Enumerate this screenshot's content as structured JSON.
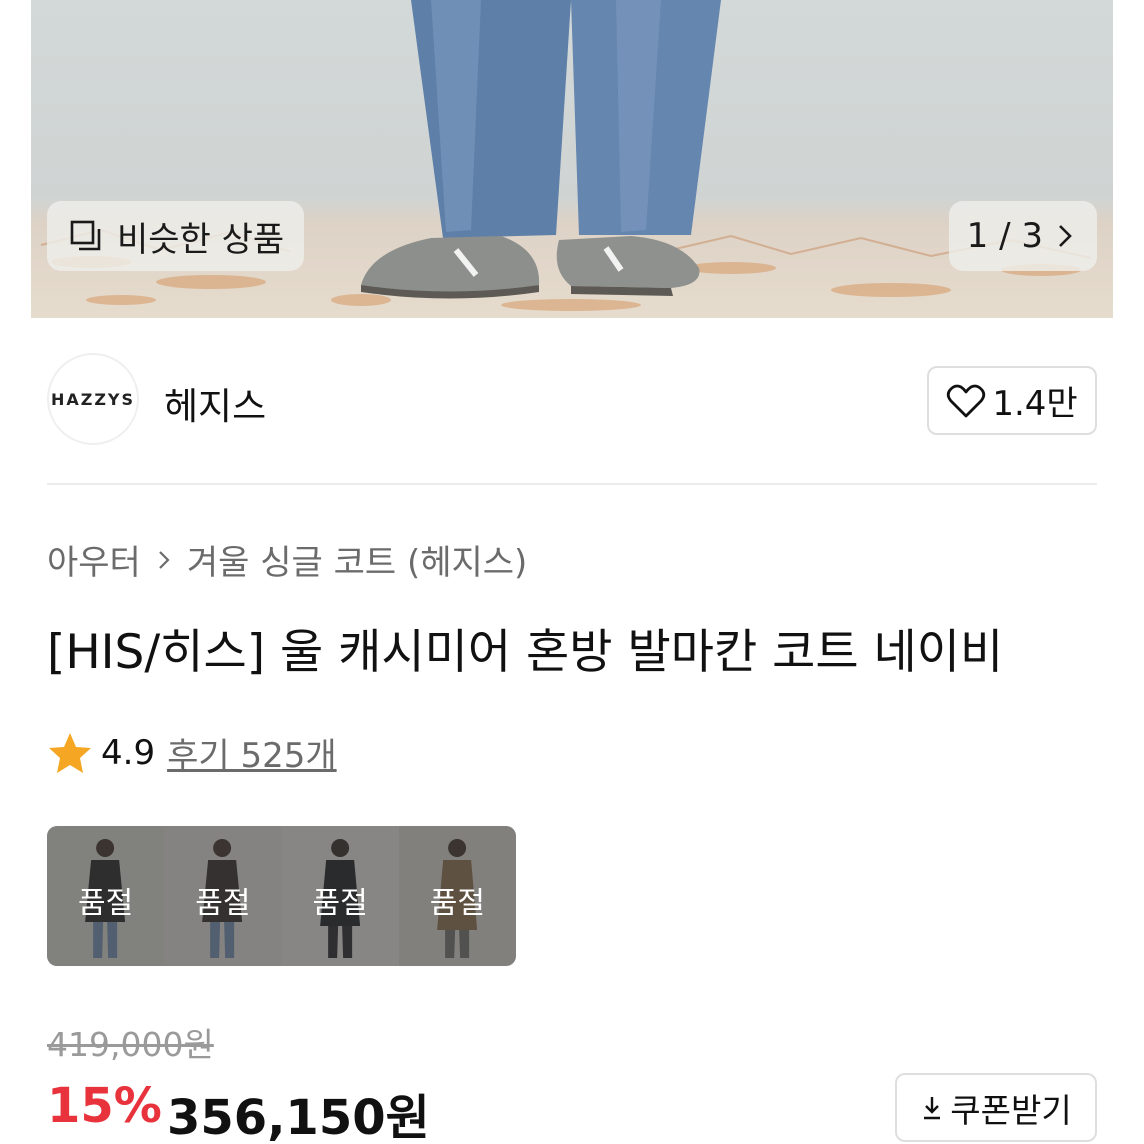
{
  "hero": {
    "similar_label": "비슷한 상품",
    "pager": "1 / 3"
  },
  "brand": {
    "logo_text": "HAZZYS",
    "name": "헤지스",
    "likes": "1.4만"
  },
  "breadcrumb": {
    "category": "아우터",
    "subcategory": "겨울 싱글 코트 (헤지스)"
  },
  "product": {
    "title": "[HIS/히스] 울 캐시미어 혼방 발마칸 코트 네이비",
    "rating": "4.9",
    "reviews": "후기 525개"
  },
  "color_options": [
    {
      "status": "품절",
      "coat_color": "#1e1e1e"
    },
    {
      "status": "품절",
      "coat_color": "#2a2522"
    },
    {
      "status": "품절",
      "coat_color": "#15171c"
    },
    {
      "status": "품절",
      "coat_color": "#8a6a48"
    }
  ],
  "price": {
    "original": "419,000원",
    "discount_rate": "15%",
    "sale": "356,150원",
    "coupon_label": "쿠폰받기"
  },
  "colors": {
    "accent_red": "#e8323c",
    "star": "#f5a623"
  }
}
